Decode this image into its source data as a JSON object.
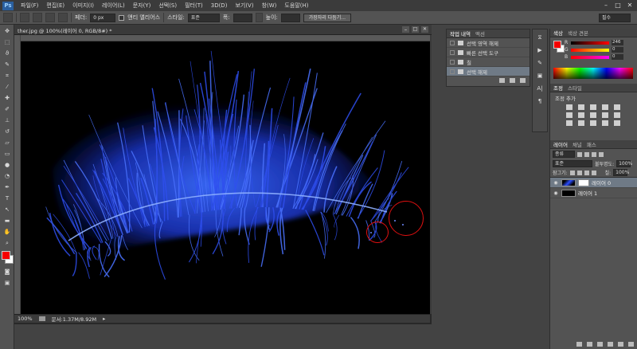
{
  "app": {
    "logo": "Ps"
  },
  "menu": [
    "파일(F)",
    "편집(E)",
    "이미지(I)",
    "레이어(L)",
    "문자(Y)",
    "선택(S)",
    "필터(T)",
    "3D(D)",
    "보기(V)",
    "창(W)",
    "도움말(H)"
  ],
  "options": {
    "feather_label": "페더:",
    "feather_value": "0 px",
    "antialias_label": "앤티 앨리어스",
    "style_label": "스타일:",
    "style_value": "표준",
    "width_label": "폭:",
    "height_label": "높이:",
    "refine_label": "가장자리 다듬기..."
  },
  "workspace": {
    "value": "필수"
  },
  "document": {
    "tab_title": "ther.jpg @ 100%(레이어 0, RGB/8#) *",
    "zoom": "100%",
    "doc_size": "문서:1.37M/8.92M"
  },
  "history": {
    "tabs": [
      "작업 내역",
      "액션"
    ],
    "items": [
      {
        "label": "선택 영역 해제"
      },
      {
        "label": "빠른 선택 도구"
      },
      {
        "label": "칠"
      },
      {
        "label": "선택 해제"
      }
    ]
  },
  "colorpanel": {
    "tabs": [
      "색상",
      "색상 견본"
    ],
    "r": "246",
    "g": "0",
    "b": "0",
    "fg_color": "#f60000",
    "bg_color": "#ffffff"
  },
  "adjustments": {
    "tabs": [
      "조정",
      "스타일"
    ],
    "title": "조정 추가"
  },
  "layers": {
    "tabs": [
      "레이어",
      "채널",
      "패스"
    ],
    "kind_label": "종류",
    "blend_mode": "표준",
    "opacity_label": "불투명도:",
    "opacity_value": "100%",
    "lock_label": "잠그기:",
    "fill_label": "칠:",
    "fill_value": "100%",
    "items": [
      {
        "name": "레이어 0"
      },
      {
        "name": "레이어 1"
      }
    ]
  },
  "colors": {
    "accent": "#e01010",
    "feather_blue": "#1e3cff"
  }
}
